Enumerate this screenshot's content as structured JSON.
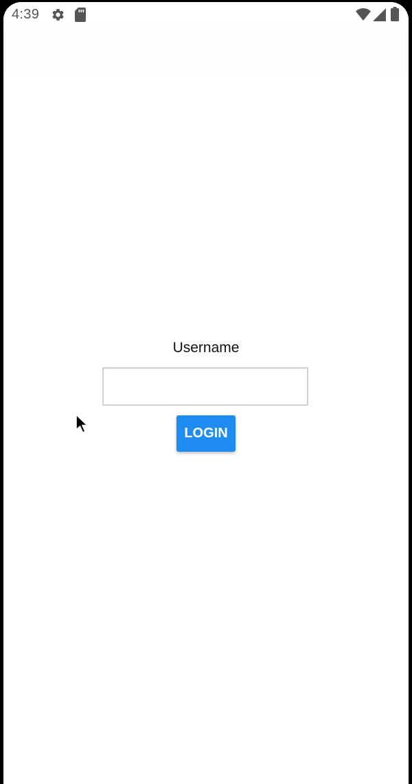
{
  "status_bar": {
    "time": "4:39",
    "left_icons": [
      "gear-icon",
      "sd-card-icon"
    ],
    "right_icons": [
      "wifi-icon",
      "cell-signal-icon",
      "battery-icon"
    ]
  },
  "login_form": {
    "username_label": "Username",
    "username_value": "",
    "username_placeholder": "",
    "login_label": "LOGIN"
  },
  "colors": {
    "primary_button": "#1e8cf0",
    "status_icons": "#555555",
    "input_border": "#d0d0d0"
  },
  "pointer": {
    "icon": "mouse-pointer-icon"
  }
}
